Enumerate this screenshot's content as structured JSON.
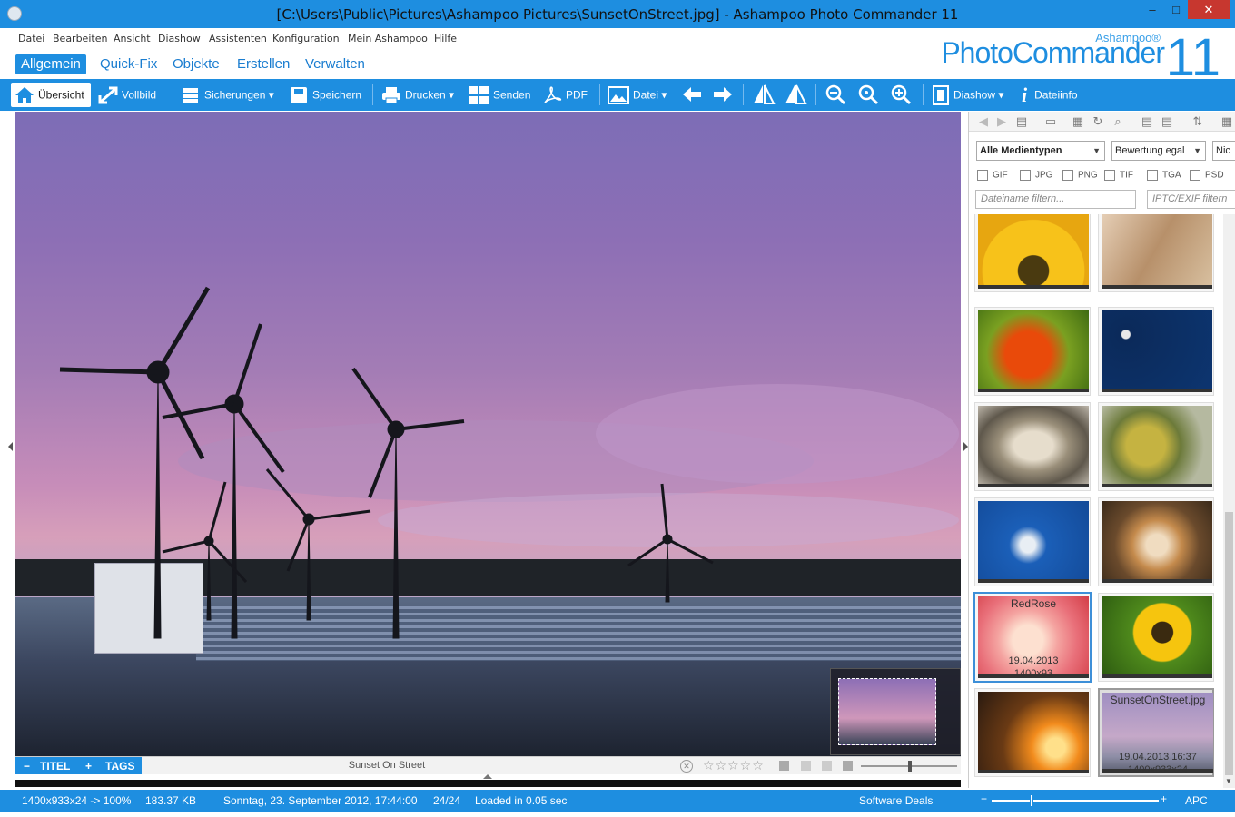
{
  "window": {
    "title": "[C:\\Users\\Public\\Pictures\\Ashampoo Pictures\\SunsetOnStreet.jpg] - Ashampoo Photo Commander 11",
    "minimize": "–",
    "maximize": "□",
    "close": "✕"
  },
  "menu": [
    "Datei",
    "Bearbeiten",
    "Ansicht",
    "Diashow",
    "Assistenten",
    "Konfiguration",
    "Mein Ashampoo",
    "Hilfe"
  ],
  "brand": {
    "small": "Ashampoo®",
    "big": "PhotoCommander",
    "num": "11"
  },
  "tabs": [
    "Allgemein",
    "Quick-Fix",
    "Objekte",
    "Erstellen",
    "Verwalten"
  ],
  "toolbar": {
    "uebersicht": "Übersicht",
    "vollbild": "Vollbild",
    "sicherungen": "Sicherungen",
    "speichern": "Speichern",
    "drucken": "Drucken",
    "senden": "Senden",
    "pdf": "PDF",
    "datei": "Datei",
    "diashow": "Diashow",
    "dateiinfo": "Dateiinfo"
  },
  "infobar": {
    "titel": "TITEL",
    "tags": "TAGS",
    "minus": "−",
    "plus": "+",
    "image_name": "Sunset On Street",
    "stars": "☆☆☆☆☆",
    "clear": "✕"
  },
  "panel": {
    "media_type": "Alle Medientypen",
    "rating": "Bewertung egal",
    "third": "Nic",
    "filetypes": [
      "GIF",
      "JPG",
      "PNG",
      "TIF",
      "TGA",
      "PSD"
    ],
    "filename_filter": "Dateiname filtern...",
    "iptc_filter": "IPTC/EXIF filtern"
  },
  "thumbs": {
    "redrose": {
      "name": "RedRose",
      "date": "19.04.2013",
      "size": "1400x93"
    },
    "sunset": {
      "name": "SunsetOnStreet.jpg",
      "date": "19.04.2013 16:37",
      "size": "1400x933x24"
    }
  },
  "status": {
    "dimensions": "1400x933x24 -> 100%",
    "filesize": "183.37 KB",
    "date": "Sonntag, 23. September 2012, 17:44:00",
    "count": "24/24",
    "loaded": "Loaded in 0.05 sec",
    "deals": "Software Deals",
    "apc": "APC",
    "minus": "−",
    "plus": "+"
  },
  "colors": {
    "accent": "#1e8ee0",
    "close": "#c7372f"
  }
}
